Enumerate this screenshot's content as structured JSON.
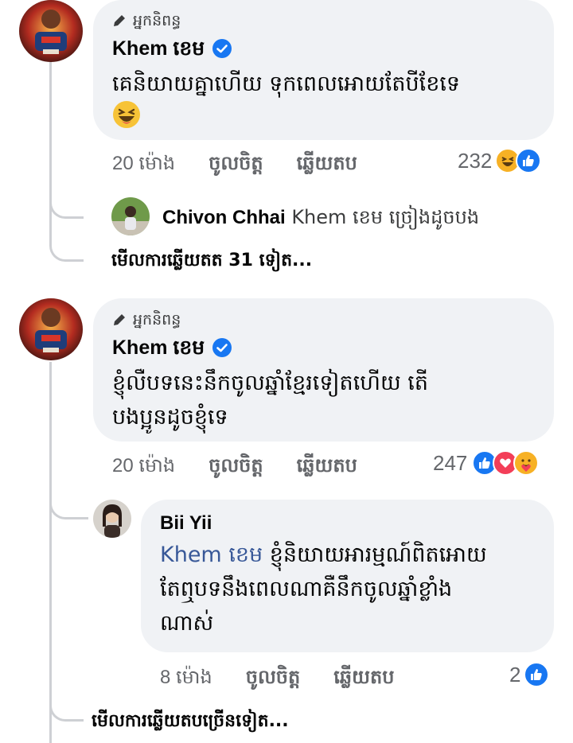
{
  "comments": [
    {
      "role": "អ្នកនិពន្ធ",
      "author": "Khem ខេម",
      "text": "គេនិយាយគ្នាហើយ ទុកពេលអោយតែបីខែទេ",
      "emoji": "😆",
      "time": "20 ម៉ោង",
      "like": "ចូលចិត្ត",
      "reply": "ឆ្លើយតប",
      "reaction_count": "232",
      "reactions": [
        "haha-icon",
        "like-icon"
      ],
      "preview_reply": {
        "author": "Chivon Chhai",
        "text": "Khem ខេម ច្រៀងដូចបង"
      },
      "more_replies": "មើលការឆ្លើយតត 31 ទៀត..."
    },
    {
      "role": "អ្នកនិពន្ធ",
      "author": "Khem ខេម",
      "text_lines": [
        "ខ្ញុំលឺបទនេះនឹកចូលឆ្នាំខ្មែរទៀតហើយ តើ",
        "បងប្អូនដូចខ្ញុំទេ"
      ],
      "time": "20 ម៉ោង",
      "like": "ចូលចិត្ត",
      "reply": "ឆ្លើយតប",
      "reaction_count": "247",
      "reactions": [
        "like-icon",
        "love-icon",
        "care-icon"
      ],
      "reply_comment": {
        "author": "Bii Yii",
        "mention": "Khem ខេម",
        "text_lines": [
          "ខ្ញុំនិយាយអារម្មណ៍ពិតអោយ",
          "តែឮបទនឹងពេលណាគឺនឹកចូលឆ្នាំខ្លាំង",
          "ណាស់"
        ],
        "time": "8 ម៉ោង",
        "like": "ចូលចិត្ត",
        "reply": "ឆ្លើយតប",
        "reaction_count": "2",
        "reactions": [
          "like-icon"
        ]
      },
      "more_replies": "មើលការឆ្លើយតបច្រើនទៀត..."
    }
  ],
  "colors": {
    "bubble": "#f0f2f5",
    "verified": "#1877f2",
    "like": "#1877f2",
    "love": "#f33e58",
    "haha": "#f7b125",
    "meta": "#65676b",
    "mention": "#385898"
  }
}
